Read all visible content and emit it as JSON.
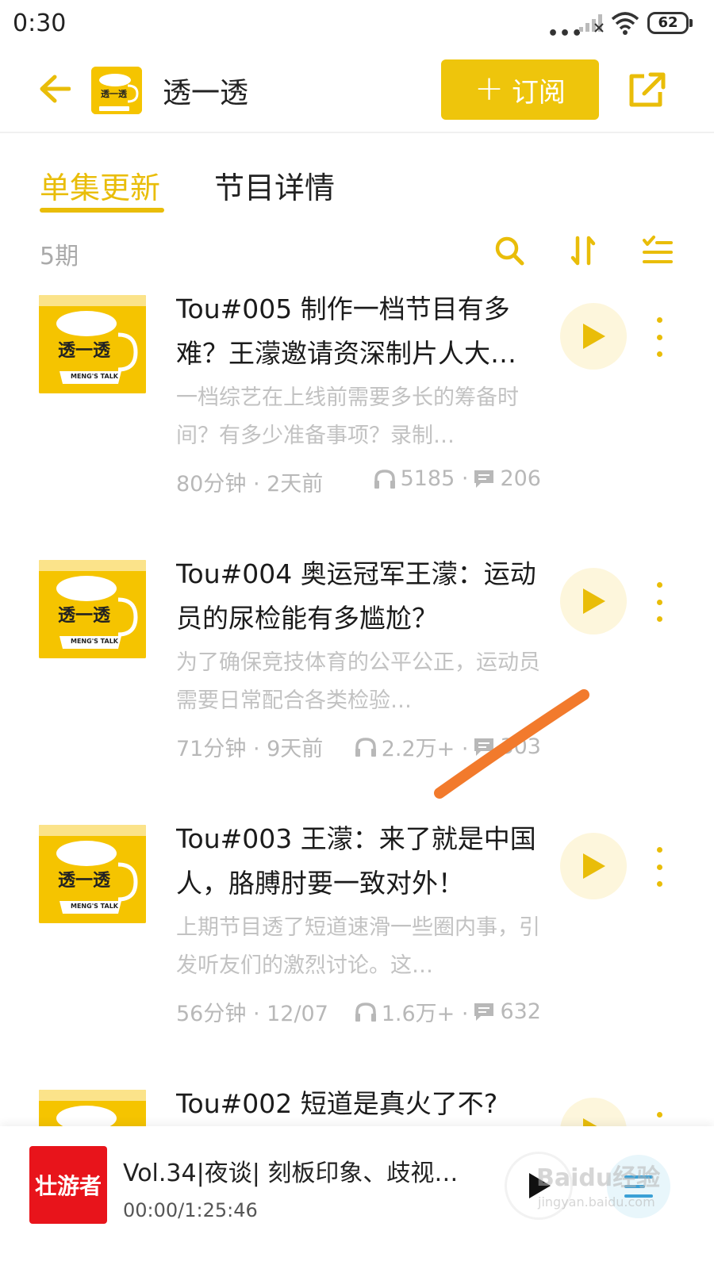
{
  "status_bar": {
    "time": "0:30",
    "dots": "•••",
    "battery": "62"
  },
  "header": {
    "title": "透一透",
    "logo_text": "透一透",
    "subscribe_label": "订阅",
    "subscribe_plus": "+"
  },
  "tabs": [
    {
      "label": "单集更新",
      "active": true
    },
    {
      "label": "节目详情",
      "active": false
    }
  ],
  "toolbar": {
    "count": "5期"
  },
  "cover_art": {
    "text": "透一透",
    "badge": "MENG'S TALK"
  },
  "episodes": [
    {
      "title": "Tou#005 制作一档节目有多难？王濛邀请资深制片人大…",
      "desc": "一档综艺在上线前需要多长的筹备时间？有多少准备事项？录制…",
      "duration": "80分钟 · 2天前",
      "plays": "5185 ·",
      "comments": "206"
    },
    {
      "title": "Tou#004 奥运冠军王濛：运动员的尿检能有多尴尬？",
      "desc": "为了确保竞技体育的公平公正，运动员需要日常配合各类检验…",
      "duration": "71分钟 · 9天前",
      "plays": "2.2万+ ·",
      "comments": "303"
    },
    {
      "title": "Tou#003 王濛：来了就是中国人，胳膊肘要一致对外！",
      "desc": "上期节目透了短道速滑一些圈内事，引发听友们的激烈讨论。这…",
      "duration": "56分钟 · 12/07",
      "plays": "1.6万+ ·",
      "comments": "632"
    },
    {
      "title": "Tou#002 短道是真火了不?",
      "desc": "",
      "duration": "",
      "plays": "",
      "comments": ""
    }
  ],
  "player": {
    "cover_text": "壮游者",
    "title": "Vol.34|夜谈| 刻板印象、歧视和…",
    "time": "00:00/1:25:46"
  },
  "watermark": {
    "text": "Baidu经验",
    "sub": "jingyan.baidu.com"
  },
  "colors": {
    "accent": "#eec50c",
    "tab_active": "#e9bd09",
    "muted_text": "#c2c2c2",
    "play_bg": "#fdf6dc",
    "annotation": "#f27a2c",
    "player_cover": "#e8141b"
  },
  "icons": {
    "back": "arrow-left-icon",
    "share": "share-external-icon",
    "search": "search-icon",
    "sort": "sort-icon",
    "multi_select": "checklist-icon",
    "headphones": "headphones-icon",
    "comment": "comment-icon",
    "play": "play-icon",
    "more": "more-vertical-icon",
    "playlist": "playlist-icon"
  }
}
